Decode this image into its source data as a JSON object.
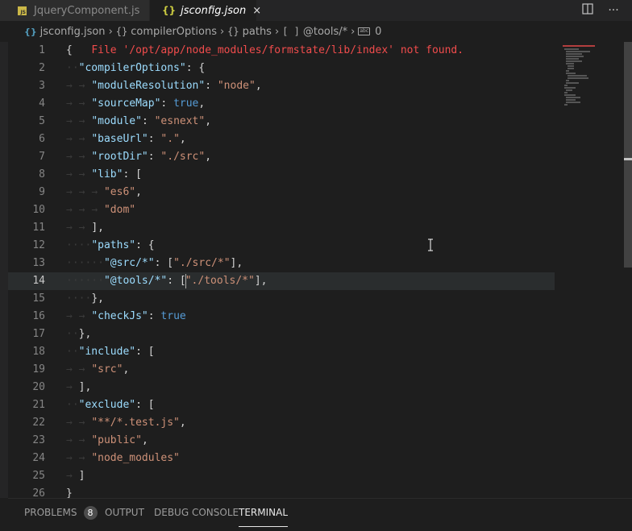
{
  "tabs": [
    {
      "label": "JqueryComponent.js",
      "icon": "js-icon",
      "badge": "JS"
    },
    {
      "label": "jsconfig.json",
      "icon": "json-icon",
      "close": "×"
    }
  ],
  "breadcrumb": {
    "file": "jsconfig.json",
    "items": [
      "compilerOptions",
      "paths",
      "@tools/*",
      "0"
    ],
    "symbols": [
      "{}",
      "{}",
      "[ ]",
      "abc"
    ]
  },
  "editor": {
    "error_message": "File '/opt/app/node_modules/formstate/lib/index' not found.",
    "active_line": 14,
    "lines": [
      {
        "n": "1"
      },
      {
        "n": "2"
      },
      {
        "n": "3"
      },
      {
        "n": "4"
      },
      {
        "n": "5"
      },
      {
        "n": "6"
      },
      {
        "n": "7"
      },
      {
        "n": "8"
      },
      {
        "n": "9"
      },
      {
        "n": "10"
      },
      {
        "n": "11"
      },
      {
        "n": "12"
      },
      {
        "n": "13"
      },
      {
        "n": "14"
      },
      {
        "n": "15"
      },
      {
        "n": "16"
      },
      {
        "n": "17"
      },
      {
        "n": "18"
      },
      {
        "n": "19"
      },
      {
        "n": "20"
      },
      {
        "n": "21"
      },
      {
        "n": "22"
      },
      {
        "n": "23"
      },
      {
        "n": "24"
      },
      {
        "n": "25"
      },
      {
        "n": "26"
      }
    ],
    "code": {
      "compilerOptions": "\"compilerOptions\"",
      "moduleResolution": "\"moduleResolution\"",
      "node": "\"node\"",
      "sourceMap": "\"sourceMap\"",
      "true": "true",
      "module": "\"module\"",
      "esnext": "\"esnext\"",
      "baseUrl": "\"baseUrl\"",
      "dot": "\".\"",
      "rootDir": "\"rootDir\"",
      "src_path": "\"./src\"",
      "lib": "\"lib\"",
      "es6": "\"es6\"",
      "dom": "\"dom\"",
      "paths": "\"paths\"",
      "src_alias": "\"@src/*\"",
      "src_alias_val": "\"./src/*\"",
      "tools_alias": "\"@tools/*\"",
      "tools_alias_val": "\"./tools/*\"",
      "checkJs": "\"checkJs\"",
      "include": "\"include\"",
      "src": "\"src\"",
      "exclude": "\"exclude\"",
      "test_glob": "\"**/*.test.js\"",
      "public": "\"public\"",
      "node_modules": "\"node_modules\""
    }
  },
  "panel": {
    "tabs": [
      "PROBLEMS",
      "OUTPUT",
      "DEBUG CONSOLE",
      "TERMINAL"
    ],
    "problems_count": "8",
    "active": "TERMINAL"
  },
  "colors": {
    "key": "#9cdcfe",
    "string": "#ce9178",
    "keyword": "#569cd6",
    "error": "#f14c4c"
  }
}
